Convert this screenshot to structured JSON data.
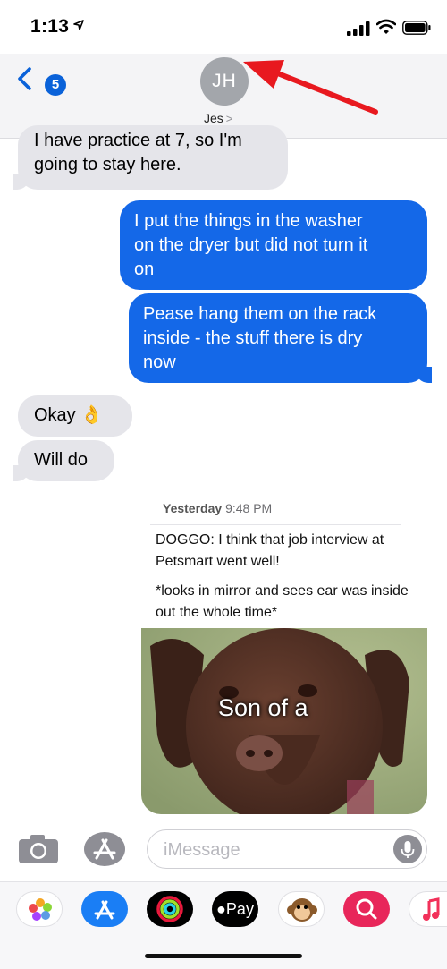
{
  "status": {
    "time": "1:13"
  },
  "header": {
    "back_badge": "5",
    "avatar_initials": "JH",
    "contact_name": "Jes",
    "chevron": ">"
  },
  "messages": {
    "m1_line1": "I have practice at 7, so I'm",
    "m1_line2": "going to stay here.",
    "m2_line1": "I put the things in the washer",
    "m2_line2": "on the dryer but did not turn it",
    "m2_line3": "on",
    "m3_line1": "Pease hang them on the rack",
    "m3_line2": "inside - the stuff there is dry",
    "m3_line3": "now",
    "m4": "Okay",
    "m4_emoji": "👌",
    "m5": "Will do"
  },
  "forward": {
    "day": "Yesterday",
    "time": "9:48 PM",
    "line1": "DOGGO: I think that job interview at",
    "line2": "Petsmart went well!",
    "line3": "*looks in mirror and sees ear was inside",
    "line4": "out the whole time*",
    "meme_caption": "Son of a"
  },
  "input": {
    "placeholder": "iMessage"
  },
  "drawer": {
    "apple_pay_label": "Pay"
  },
  "colors": {
    "outgoing": "#1468e8",
    "incoming": "#e5e5ea",
    "arrow": "#e8191f"
  }
}
